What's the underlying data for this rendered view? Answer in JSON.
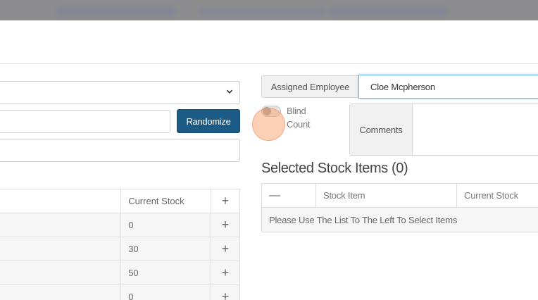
{
  "form": {
    "randomize_label": "Randomize"
  },
  "left_table": {
    "header": {
      "current_stock": "Current Stock",
      "add": "+"
    },
    "rows": [
      {
        "current_stock": "0",
        "add": "+"
      },
      {
        "current_stock": "30",
        "add": "+"
      },
      {
        "current_stock": "50",
        "add": "+"
      },
      {
        "current_stock": "0",
        "add": "+"
      }
    ]
  },
  "assigned_employee": {
    "label": "Assigned Employee",
    "value": "Cloe Mcpherson"
  },
  "blind_count": {
    "label": "Blind Count",
    "enabled": false
  },
  "comments": {
    "label": "Comments",
    "value": ""
  },
  "selected_stock": {
    "heading": "Selected Stock Items (0)",
    "columns": [
      "—",
      "Stock Item",
      "Current Stock"
    ],
    "empty_message": "Please Use The List To The Left To Select Items"
  },
  "icons": {
    "select_chevron": "chevron-down-icon"
  }
}
